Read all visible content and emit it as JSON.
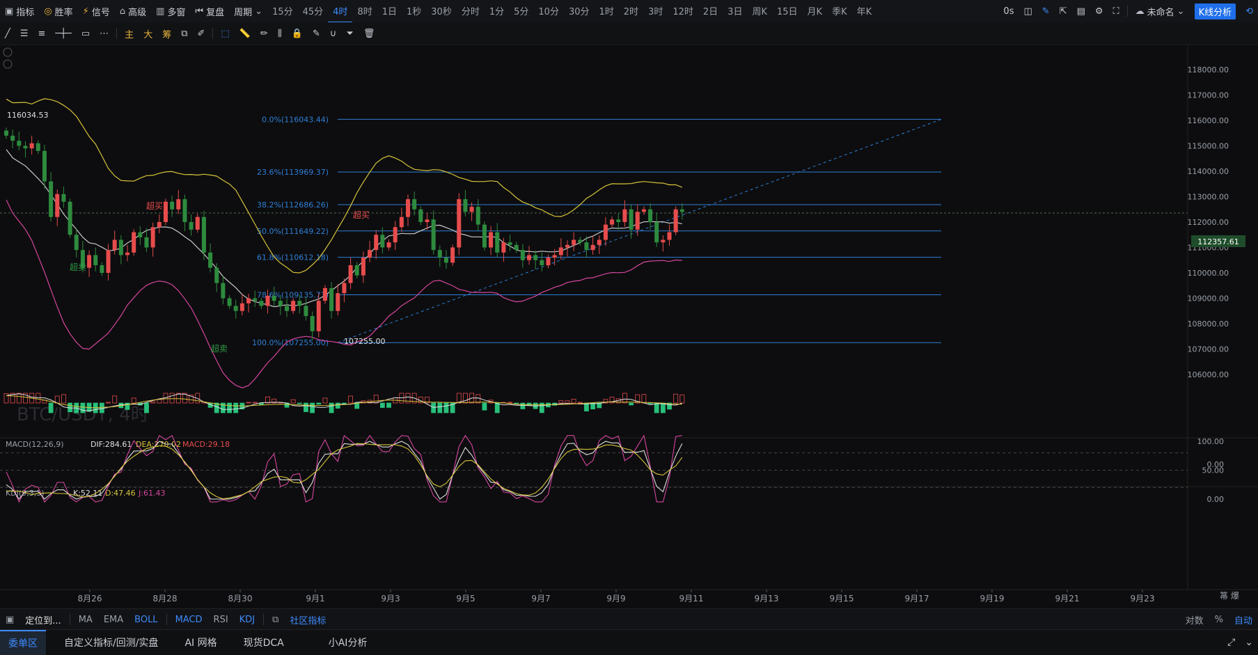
{
  "colors": {
    "up": "#e74c4c",
    "down": "#2e8b3e",
    "fib": "#2e7fd6",
    "boll_mid": "#c8c8c8",
    "boll_up": "#d7c43a",
    "boll_low": "#d6469e",
    "accent": "#3d8bfd",
    "kdj_k": "#e0e0e0",
    "kdj_d": "#d7c43a",
    "kdj_j": "#d6469e"
  },
  "top_toolbar": {
    "indicators": "指标",
    "winrate": "胜率",
    "signal": "信号",
    "advanced": "高级",
    "multi_window": "多窗",
    "replay": "复盘",
    "period": "周期",
    "timeframes": [
      "15分",
      "45分",
      "4时",
      "8时",
      "1日",
      "1秒",
      "30秒",
      "分时",
      "1分",
      "5分",
      "10分",
      "30分",
      "1时",
      "2时",
      "3时",
      "12时",
      "2日",
      "3日",
      "周K",
      "15日",
      "月K",
      "季K",
      "年K"
    ],
    "active_timeframe": "4时",
    "countdown": "0s",
    "unnamed": "未命名",
    "kline_analysis": "K线分析"
  },
  "draw_toolbar": {
    "main": "主",
    "big": "大",
    "chips": "筹"
  },
  "chart": {
    "symbol_watermark": "BTC/USDT, 4时",
    "price_axis": [
      "118000.00",
      "117000.00",
      "116000.00",
      "115000.00",
      "114000.00",
      "113000.00",
      "112000.00",
      "111000.00",
      "110000.00",
      "109000.00",
      "108000.00",
      "107000.00",
      "106000.00"
    ],
    "current_price": "112357.61",
    "high_marker": "116034.53",
    "low_marker": "107255.00",
    "fib_levels": [
      {
        "label": "0.0%(116043.44)",
        "price": 116043.44
      },
      {
        "label": "23.6%(113969.37)",
        "price": 113969.37
      },
      {
        "label": "38.2%(112686.26)",
        "price": 112686.26
      },
      {
        "label": "50.0%(111649.22)",
        "price": 111649.22
      },
      {
        "label": "61.8%(110612.18)",
        "price": 110612.18
      },
      {
        "label": "78.6%(109135.73)",
        "price": 109135.73
      },
      {
        "label": "100.0%(107255.00)",
        "price": 107255.0
      }
    ],
    "signals": [
      {
        "text": "超买",
        "type": "overbought"
      },
      {
        "text": "超卖",
        "type": "oversold"
      },
      {
        "text": "超卖",
        "type": "oversold"
      },
      {
        "text": "超买",
        "type": "overbought"
      }
    ],
    "date_axis": [
      "8月26",
      "8月28",
      "8月30",
      "9月1",
      "9月3",
      "9月5",
      "9月7",
      "9月9",
      "9月11",
      "9月13",
      "9月15",
      "9月17",
      "9月19",
      "9月21",
      "9月23"
    ]
  },
  "chart_data": {
    "type": "candlestick",
    "closes": [
      115400,
      115200,
      115000,
      114900,
      115100,
      114800,
      113600,
      112200,
      113100,
      112800,
      111500,
      110900,
      110200,
      110700,
      110300,
      110000,
      110900,
      111300,
      110700,
      110800,
      111600,
      111400,
      111000,
      111800,
      112000,
      112800,
      112500,
      112900,
      112000,
      111700,
      112200,
      110800,
      110200,
      109600,
      109000,
      108700,
      108500,
      108800,
      109000,
      108900,
      108700,
      109100,
      108900,
      108700,
      108500,
      108900,
      108700,
      108300,
      107700,
      108900,
      109400,
      108500,
      109200,
      109600,
      110300,
      109900,
      110600,
      110900,
      111500,
      111000,
      111200,
      111800,
      112200,
      112900,
      112500,
      112000,
      112100,
      110900,
      110600,
      110400,
      111000,
      112900,
      112400,
      112600,
      111900,
      111000,
      111600,
      110800,
      111200,
      111100,
      110900,
      110500,
      110700,
      110500,
      110300,
      110600,
      110700,
      111000,
      111100,
      111300,
      111200,
      110900,
      111100,
      111300,
      111900,
      112100,
      112000,
      112500,
      111700,
      112400,
      112500,
      112000,
      111200,
      111300,
      111600,
      112500,
      112400
    ],
    "macd": {
      "dif": "284.61",
      "dea": "270.02",
      "macd": "29.18",
      "axis": [
        "0.00"
      ]
    },
    "kdj": {
      "k": "52.11",
      "d": "47.46",
      "j": "61.43",
      "axis": [
        "100.00",
        "50.00",
        "0.00"
      ]
    }
  },
  "indicator_labels": {
    "macd": "MACD(12,26,9)",
    "macd_dif": "DIF:284.61",
    "macd_dea": "DEA:270.02",
    "macd_macd": "MACD:29.18",
    "kdj": "KDJ(9,3,3)",
    "kdj_k": "K:52.11",
    "kdj_d": "D:47.46",
    "kdj_j": "J:61.43"
  },
  "bottom_indicators": {
    "locate": "定位到...",
    "items": [
      "MA",
      "EMA",
      "BOLL",
      "MACD",
      "RSI",
      "KDJ"
    ],
    "community": "社区指标",
    "log": "对数",
    "percent": "%",
    "auto": "自动"
  },
  "bottom_tabs": [
    "委单区",
    "自定义指标/回测/实盘",
    "AI 网格",
    "现货DCA",
    "小AI分析"
  ]
}
